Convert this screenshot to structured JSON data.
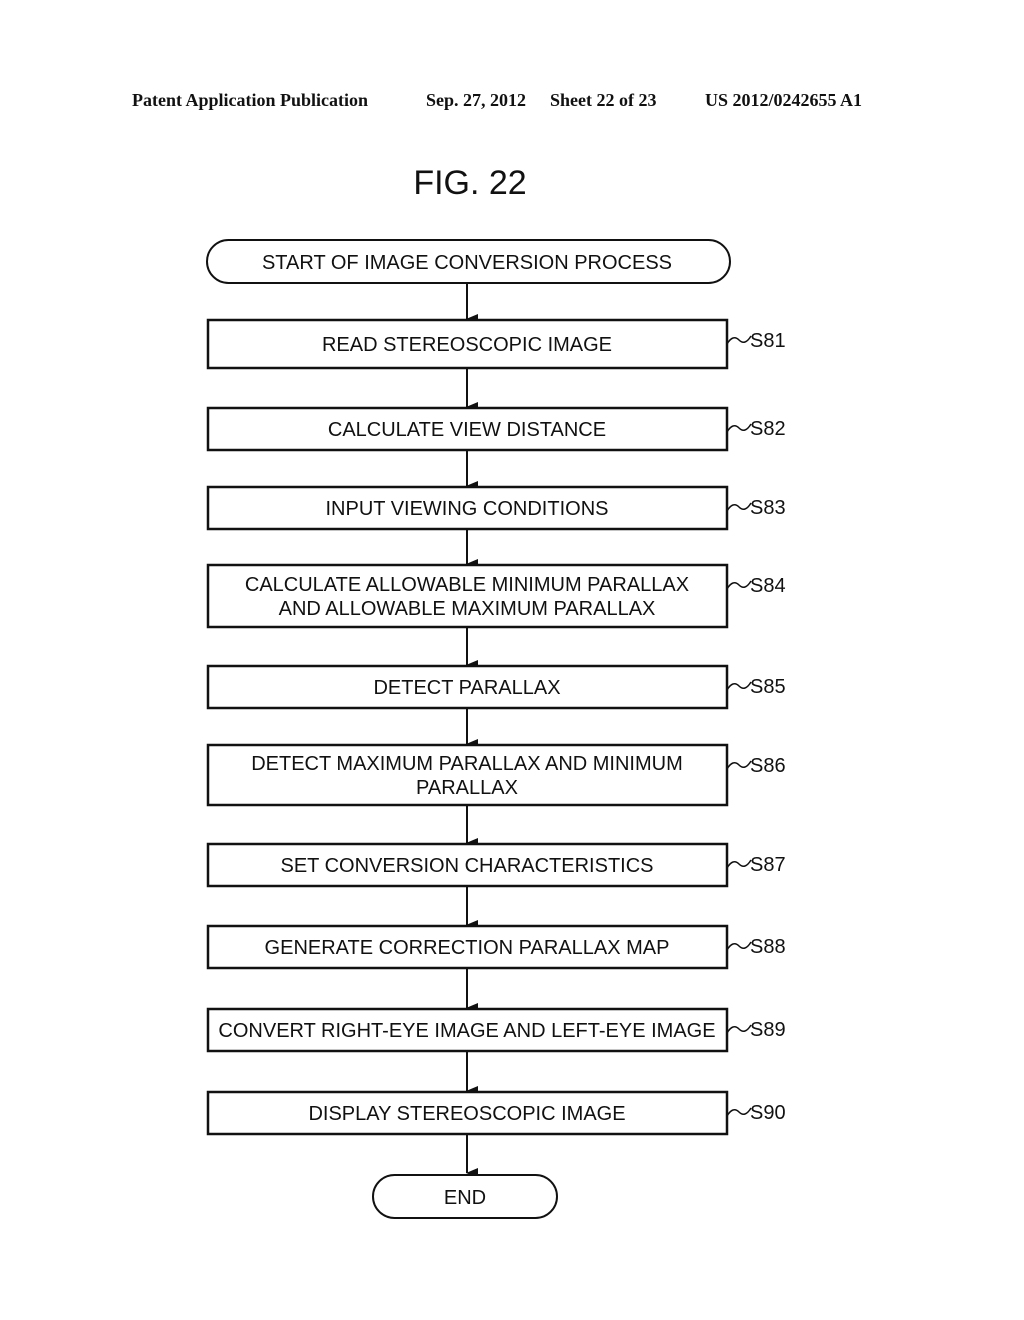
{
  "header": {
    "publication": "Patent Application Publication",
    "date": "Sep. 27, 2012",
    "sheet": "Sheet 22 of 23",
    "patent_number": "US 2012/0242655 A1"
  },
  "figure": {
    "title": "FIG. 22"
  },
  "flowchart": {
    "start": "START OF IMAGE CONVERSION PROCESS",
    "steps": [
      {
        "id": "S81",
        "lines": [
          "READ STEREOSCOPIC IMAGE"
        ]
      },
      {
        "id": "S82",
        "lines": [
          "CALCULATE VIEW DISTANCE"
        ]
      },
      {
        "id": "S83",
        "lines": [
          "INPUT VIEWING CONDITIONS"
        ]
      },
      {
        "id": "S84",
        "lines": [
          "CALCULATE ALLOWABLE MINIMUM PARALLAX",
          "AND ALLOWABLE MAXIMUM PARALLAX"
        ]
      },
      {
        "id": "S85",
        "lines": [
          "DETECT PARALLAX"
        ]
      },
      {
        "id": "S86",
        "lines": [
          "DETECT MAXIMUM PARALLAX AND MINIMUM",
          "PARALLAX"
        ]
      },
      {
        "id": "S87",
        "lines": [
          "SET CONVERSION CHARACTERISTICS"
        ]
      },
      {
        "id": "S88",
        "lines": [
          "GENERATE CORRECTION PARALLAX MAP"
        ]
      },
      {
        "id": "S89",
        "lines": [
          "CONVERT RIGHT-EYE IMAGE AND LEFT-EYE IMAGE"
        ]
      },
      {
        "id": "S90",
        "lines": [
          "DISPLAY STEREOSCOPIC IMAGE"
        ]
      }
    ],
    "end": "END"
  }
}
